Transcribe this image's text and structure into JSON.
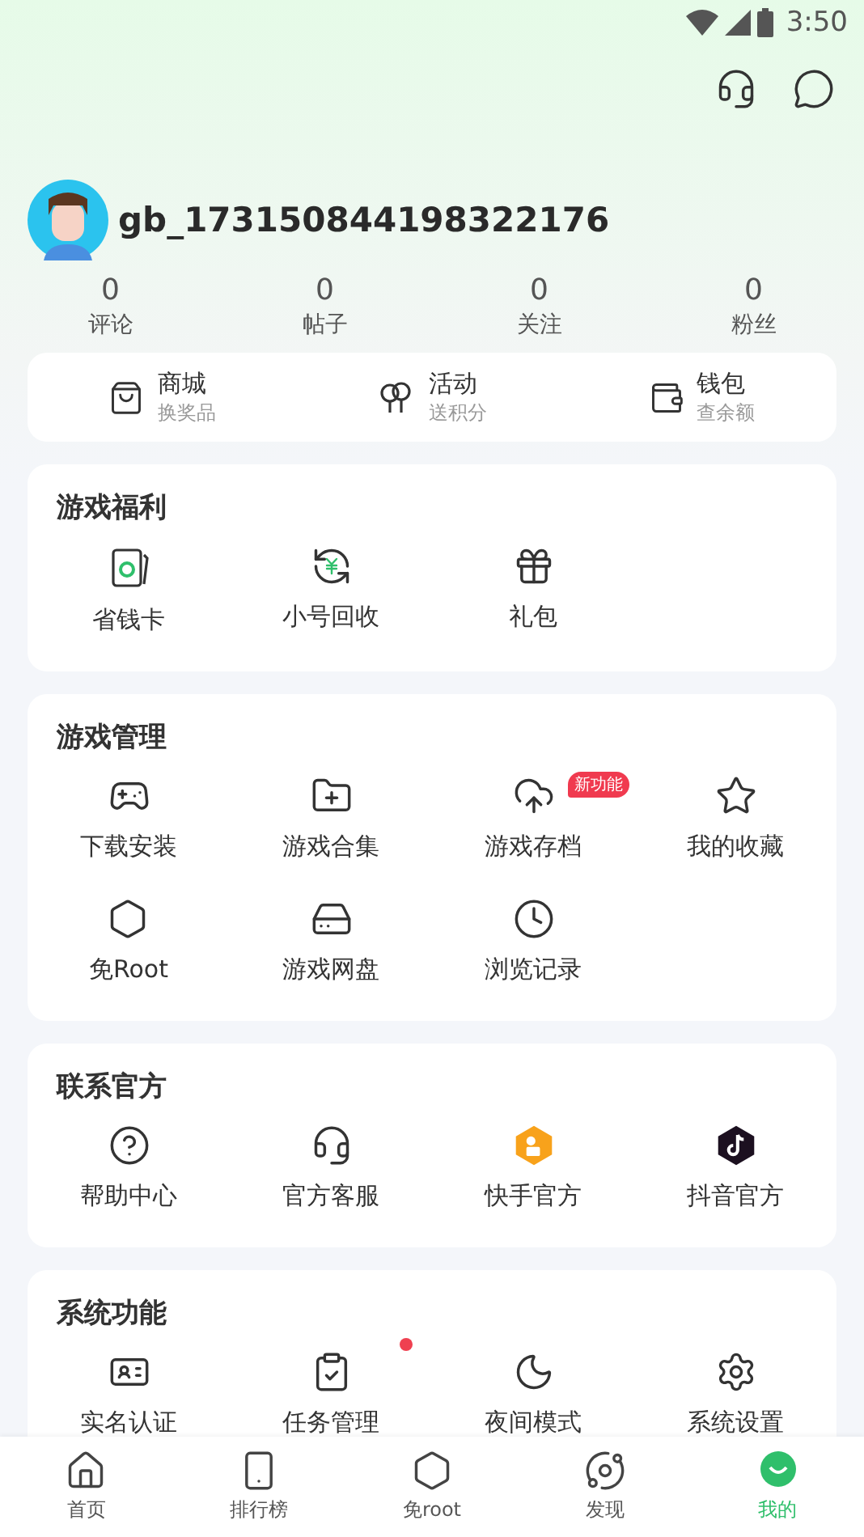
{
  "status_bar": {
    "time": "3:50"
  },
  "profile": {
    "username": "gb_173150844198322176"
  },
  "stats": [
    {
      "value": "0",
      "label": "评论"
    },
    {
      "value": "0",
      "label": "帖子"
    },
    {
      "value": "0",
      "label": "关注"
    },
    {
      "value": "0",
      "label": "粉丝"
    }
  ],
  "quick_links": [
    {
      "title": "商城",
      "subtitle": "换奖品"
    },
    {
      "title": "活动",
      "subtitle": "送积分"
    },
    {
      "title": "钱包",
      "subtitle": "查余额"
    }
  ],
  "sections": [
    {
      "title": "游戏福利",
      "items": [
        {
          "label": "省钱卡"
        },
        {
          "label": "小号回收"
        },
        {
          "label": "礼包"
        }
      ]
    },
    {
      "title": "游戏管理",
      "items": [
        {
          "label": "下载安装"
        },
        {
          "label": "游戏合集"
        },
        {
          "label": "游戏存档",
          "badge": "新功能"
        },
        {
          "label": "我的收藏"
        },
        {
          "label": "免Root"
        },
        {
          "label": "游戏网盘"
        },
        {
          "label": "浏览记录"
        }
      ]
    },
    {
      "title": "联系官方",
      "items": [
        {
          "label": "帮助中心"
        },
        {
          "label": "官方客服"
        },
        {
          "label": "快手官方"
        },
        {
          "label": "抖音官方"
        }
      ]
    },
    {
      "title": "系统功能",
      "items": [
        {
          "label": "实名认证",
          "dot": false
        },
        {
          "label": "任务管理",
          "dot": true
        },
        {
          "label": "夜间模式",
          "dot": false
        },
        {
          "label": "系统设置",
          "dot": false
        }
      ]
    }
  ],
  "bottom_nav": [
    {
      "label": "首页",
      "selected": false
    },
    {
      "label": "排行榜",
      "selected": false
    },
    {
      "label": "免root",
      "selected": false
    },
    {
      "label": "发现",
      "selected": false
    },
    {
      "label": "我的",
      "selected": true
    }
  ]
}
